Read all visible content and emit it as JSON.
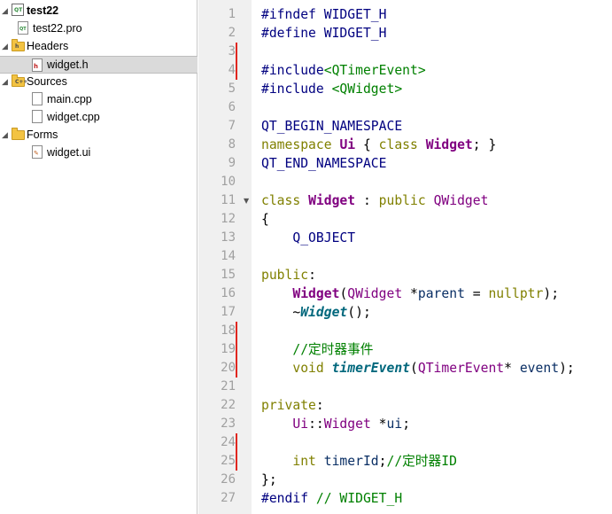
{
  "project_tree": {
    "items": [
      {
        "label": "test22",
        "kind": "project",
        "expanded": true,
        "bold": true
      },
      {
        "label": "test22.pro",
        "kind": "pro-file"
      },
      {
        "label": "Headers",
        "kind": "folder",
        "expanded": true,
        "folder_badge": "h"
      },
      {
        "label": "widget.h",
        "kind": "header-file",
        "selected": true
      },
      {
        "label": "Sources",
        "kind": "folder",
        "expanded": true,
        "folder_badge": "C++"
      },
      {
        "label": "main.cpp",
        "kind": "source-file"
      },
      {
        "label": "widget.cpp",
        "kind": "source-file"
      },
      {
        "label": "Forms",
        "kind": "folder",
        "expanded": true,
        "folder_badge": ""
      },
      {
        "label": "widget.ui",
        "kind": "form-file"
      }
    ]
  },
  "editor": {
    "change_marker_color": "#e0261f",
    "changed_lines": [
      3,
      4,
      18,
      19,
      20,
      24,
      25
    ],
    "fold_lines": [
      11
    ],
    "lines": [
      {
        "n": "1",
        "tokens": [
          [
            "#ifndef WIDGET_H",
            "pp"
          ]
        ]
      },
      {
        "n": "2",
        "tokens": [
          [
            "#define WIDGET_H",
            "pp"
          ]
        ]
      },
      {
        "n": "3",
        "tokens": []
      },
      {
        "n": "4",
        "tokens": [
          [
            "#include",
            "pp"
          ],
          [
            "<QTimerEvent>",
            "inc"
          ]
        ]
      },
      {
        "n": "5",
        "tokens": [
          [
            "#include ",
            "pp"
          ],
          [
            "<QWidget>",
            "inc"
          ]
        ]
      },
      {
        "n": "6",
        "tokens": []
      },
      {
        "n": "7",
        "tokens": [
          [
            "QT_BEGIN_NAMESPACE",
            "def"
          ]
        ]
      },
      {
        "n": "8",
        "tokens": [
          [
            "namespace ",
            "kw"
          ],
          [
            "Ui",
            "cls"
          ],
          [
            " { ",
            "plain"
          ],
          [
            "class ",
            "kw"
          ],
          [
            "Widget",
            "cls"
          ],
          [
            "; }",
            "plain"
          ]
        ]
      },
      {
        "n": "9",
        "tokens": [
          [
            "QT_END_NAMESPACE",
            "def"
          ]
        ]
      },
      {
        "n": "10",
        "tokens": []
      },
      {
        "n": "11",
        "tokens": [
          [
            "class ",
            "kw"
          ],
          [
            "Widget",
            "cls"
          ],
          [
            " : ",
            "plain"
          ],
          [
            "public ",
            "kw"
          ],
          [
            "QWidget",
            "qt"
          ]
        ]
      },
      {
        "n": "12",
        "tokens": [
          [
            "{",
            "plain"
          ]
        ]
      },
      {
        "n": "13",
        "tokens": [
          [
            "    Q_OBJECT",
            "def"
          ]
        ]
      },
      {
        "n": "14",
        "tokens": []
      },
      {
        "n": "15",
        "tokens": [
          [
            "public",
            "kw"
          ],
          [
            ":",
            "plain"
          ]
        ]
      },
      {
        "n": "16",
        "tokens": [
          [
            "    ",
            "plain"
          ],
          [
            "Widget",
            "cls"
          ],
          [
            "(",
            "plain"
          ],
          [
            "QWidget",
            "qt"
          ],
          [
            " *",
            "plain"
          ],
          [
            "parent",
            "var"
          ],
          [
            " = ",
            "plain"
          ],
          [
            "nullptr",
            "kw"
          ],
          [
            ");",
            "plain"
          ]
        ]
      },
      {
        "n": "17",
        "tokens": [
          [
            "    ~",
            "plain"
          ],
          [
            "Widget",
            "fnitalic"
          ],
          [
            "();",
            "plain"
          ]
        ]
      },
      {
        "n": "18",
        "tokens": []
      },
      {
        "n": "19",
        "tokens": [
          [
            "    //定时器事件",
            "cm"
          ]
        ]
      },
      {
        "n": "20",
        "tokens": [
          [
            "    ",
            "plain"
          ],
          [
            "void ",
            "kw"
          ],
          [
            "timerEvent",
            "fn"
          ],
          [
            "(",
            "plain"
          ],
          [
            "QTimerEvent",
            "qt"
          ],
          [
            "* ",
            "plain"
          ],
          [
            "event",
            "var"
          ],
          [
            ");",
            "plain"
          ]
        ]
      },
      {
        "n": "21",
        "tokens": []
      },
      {
        "n": "22",
        "tokens": [
          [
            "private",
            "kw"
          ],
          [
            ":",
            "plain"
          ]
        ]
      },
      {
        "n": "23",
        "tokens": [
          [
            "    ",
            "plain"
          ],
          [
            "Ui",
            "ty"
          ],
          [
            "::",
            "plain"
          ],
          [
            "Widget",
            "ty"
          ],
          [
            " *",
            "plain"
          ],
          [
            "ui",
            "var"
          ],
          [
            ";",
            "plain"
          ]
        ]
      },
      {
        "n": "24",
        "tokens": []
      },
      {
        "n": "25",
        "tokens": [
          [
            "    ",
            "plain"
          ],
          [
            "int ",
            "kw"
          ],
          [
            "timerId",
            "var"
          ],
          [
            ";",
            "plain"
          ],
          [
            "//定时器ID",
            "cm"
          ]
        ]
      },
      {
        "n": "26",
        "tokens": [
          [
            "};",
            "plain"
          ]
        ]
      },
      {
        "n": "27",
        "tokens": [
          [
            "#endif ",
            "pp"
          ],
          [
            "// WIDGET_H",
            "cm"
          ]
        ]
      }
    ]
  }
}
